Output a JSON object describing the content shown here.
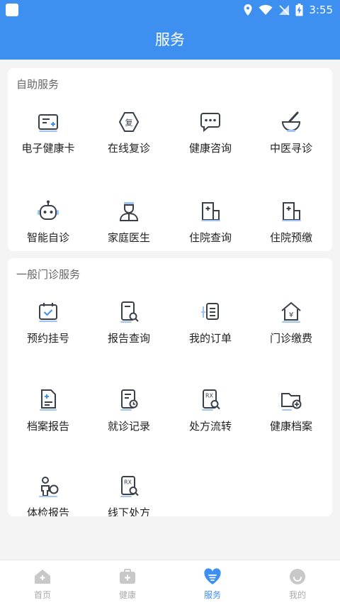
{
  "status_bar": {
    "time": "3:55"
  },
  "header": {
    "title": "服务"
  },
  "self_service": {
    "title": "自助服务",
    "items": [
      {
        "label": "电子健康卡",
        "icon": "health-card-icon"
      },
      {
        "label": "在线复诊",
        "icon": "follow-up-icon"
      },
      {
        "label": "健康咨询",
        "icon": "chat-consult-icon"
      },
      {
        "label": "中医寻诊",
        "icon": "mortar-pestle-icon"
      },
      {
        "label": "智能自诊",
        "icon": "robot-icon"
      },
      {
        "label": "家庭医生",
        "icon": "doctor-icon"
      },
      {
        "label": "住院查询",
        "icon": "hospital-building-icon"
      },
      {
        "label": "住院预缴",
        "icon": "hospital-building-icon"
      }
    ]
  },
  "outpatient": {
    "title": "一般门诊服务",
    "items": [
      {
        "label": "预约挂号",
        "icon": "calendar-check-icon"
      },
      {
        "label": "报告查询",
        "icon": "report-search-icon"
      },
      {
        "label": "我的订单",
        "icon": "order-list-icon"
      },
      {
        "label": "门诊缴费",
        "icon": "payment-house-icon"
      },
      {
        "label": "档案报告",
        "icon": "file-medical-icon"
      },
      {
        "label": "就诊记录",
        "icon": "clock-record-icon"
      },
      {
        "label": "处方流转",
        "icon": "rx-search-icon"
      },
      {
        "label": "健康档案",
        "icon": "folder-add-icon"
      },
      {
        "label": "体检报告",
        "icon": "checkup-person-icon"
      },
      {
        "label": "线下处方",
        "icon": "rx-search-icon"
      }
    ]
  },
  "bottom_nav": {
    "tabs": [
      {
        "label": "首页",
        "icon": "home-icon",
        "active": false
      },
      {
        "label": "健康",
        "icon": "medkit-icon",
        "active": false
      },
      {
        "label": "服务",
        "icon": "heart-service-icon",
        "active": true
      },
      {
        "label": "我的",
        "icon": "profile-icon",
        "active": false
      }
    ]
  },
  "colors": {
    "primary": "#3d8ff0",
    "icon_dark": "#3a3f4a",
    "icon_accent": "#9dc4f5"
  }
}
